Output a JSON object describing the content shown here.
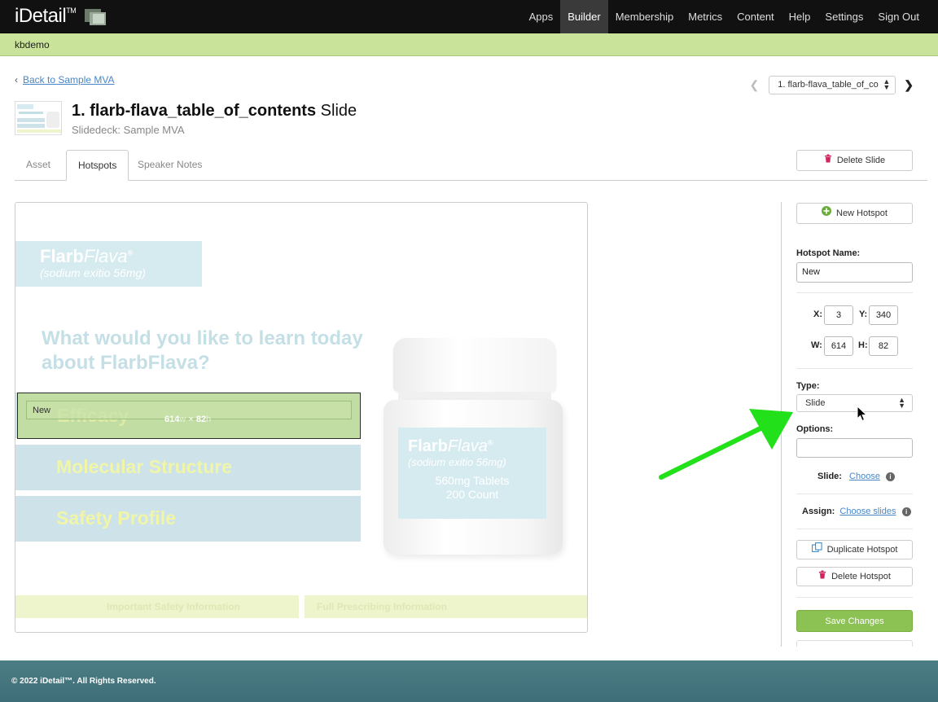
{
  "app": {
    "logo_text": "iDetail",
    "logo_tm": "TM",
    "nav": [
      "Apps",
      "Builder",
      "Membership",
      "Metrics",
      "Content",
      "Help",
      "Settings",
      "Sign Out"
    ],
    "active_nav": "Builder",
    "user": "kbdemo"
  },
  "page": {
    "back_label": "Back to Sample MVA",
    "slide_select_value": "1. flarb-flava_table_of_co",
    "title_bold": "1. flarb-flava_table_of_contents",
    "title_rest": "Slide",
    "subtitle": "Slidedeck: Sample MVA",
    "tabs": [
      "Asset",
      "Hotspots",
      "Speaker Notes"
    ],
    "active_tab": "Hotspots",
    "delete_slide_label": "Delete Slide"
  },
  "slide": {
    "brand_bold": "Flarb",
    "brand_italic": "Flava",
    "brand_reg": "®",
    "brand_sub": "(sodium exitio 56mg)",
    "question": "What would you like to learn today about FlarbFlava?",
    "menu": [
      "Efficacy",
      "Molecular Structure",
      "Safety Profile"
    ],
    "hotspot_label": "New",
    "hotspot_w": "614",
    "hotspot_w_unit": "w",
    "hotspot_x": "×",
    "hotspot_h": "82",
    "hotspot_h_unit": "h",
    "bottle_brand_bold": "Flarb",
    "bottle_brand_italic": "Flava",
    "bottle_reg": "®",
    "bottle_sub": "(sodium exitio 56mg)",
    "bottle_l1": "560mg Tablets",
    "bottle_l2": "200 Count",
    "footer_links": [
      "Important Safety Information",
      "Full Prescribing Information"
    ]
  },
  "panel": {
    "new_hotspot_label": "New Hotspot",
    "name_label": "Hotspot Name:",
    "name_value": "New",
    "x_label": "X:",
    "x_value": "3",
    "y_label": "Y:",
    "y_value": "340",
    "w_label": "W:",
    "w_value": "614",
    "h_label": "H:",
    "h_value": "82",
    "type_label": "Type:",
    "type_value": "Slide",
    "options_label": "Options:",
    "options_value": "",
    "slide_label": "Slide:",
    "slide_link": "Choose",
    "assign_label": "Assign:",
    "assign_link": "Choose slides",
    "duplicate_label": "Duplicate Hotspot",
    "delete_label": "Delete Hotspot",
    "save_label": "Save Changes"
  },
  "footer": {
    "copyright": "© 2022 iDetail™.  All Rights Reserved."
  },
  "colors": {
    "nav_bg": "#111111",
    "user_bar": "#c9e39b",
    "link": "#4a86c5",
    "save": "#8cc154",
    "delete_icon": "#d0245e",
    "add_icon": "#6aab3a",
    "annotation_arrow": "#22e01a",
    "footer_bg": "#4c7c84"
  },
  "icons": [
    "logo-mark-icon",
    "chevron-left-icon",
    "chevron-right-icon",
    "trash-icon",
    "plus-circle-icon",
    "copy-icon",
    "info-icon",
    "sort-arrows-icon",
    "cursor-icon",
    "annotation-arrow-icon"
  ]
}
